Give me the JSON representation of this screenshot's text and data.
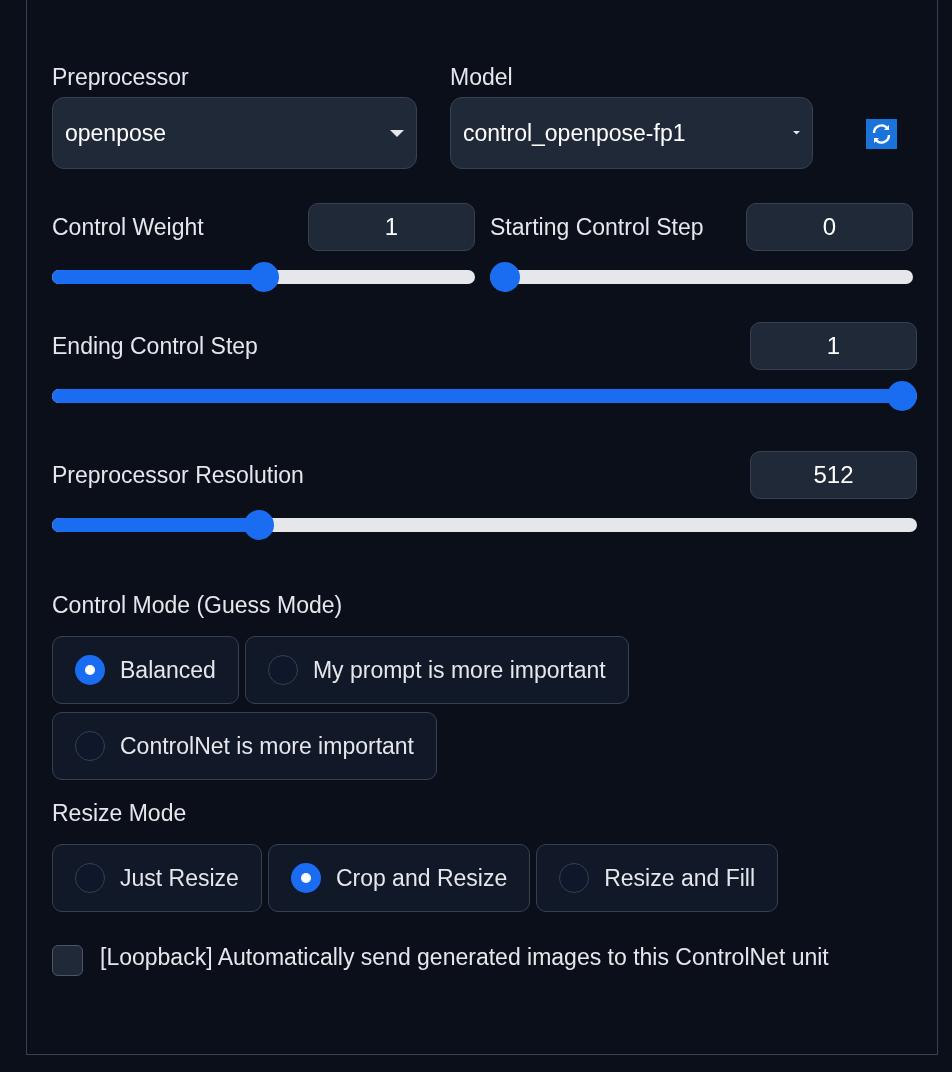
{
  "preprocessor": {
    "label": "Preprocessor",
    "value": "openpose"
  },
  "model": {
    "label": "Model",
    "value": "control_openpose-fp1"
  },
  "sliders_top": [
    {
      "label": "Control Weight",
      "reading": "1",
      "level": 0.5
    },
    {
      "label": "Starting Control Step",
      "reading": "0",
      "level": 0
    }
  ],
  "sliders": [
    {
      "label": "Ending Control Step",
      "reading": "1",
      "level": 1
    },
    {
      "label": "Preprocessor Resolution",
      "reading": "512",
      "level": 0.23
    }
  ],
  "control_mode": {
    "label": "Control Mode (Guess Mode)",
    "options": [
      {
        "label": "Balanced",
        "selected": true
      },
      {
        "label": "My prompt is more important",
        "selected": false
      },
      {
        "label": "ControlNet is more important",
        "selected": false
      }
    ]
  },
  "resize_mode": {
    "label": "Resize Mode",
    "options": [
      {
        "label": "Just Resize",
        "selected": false
      },
      {
        "label": "Crop and Resize",
        "selected": true
      },
      {
        "label": "Resize and Fill",
        "selected": false
      }
    ]
  },
  "loopback": {
    "label": "[Loopback] Automatically send generated images to this ControlNet unit",
    "checked": false
  }
}
